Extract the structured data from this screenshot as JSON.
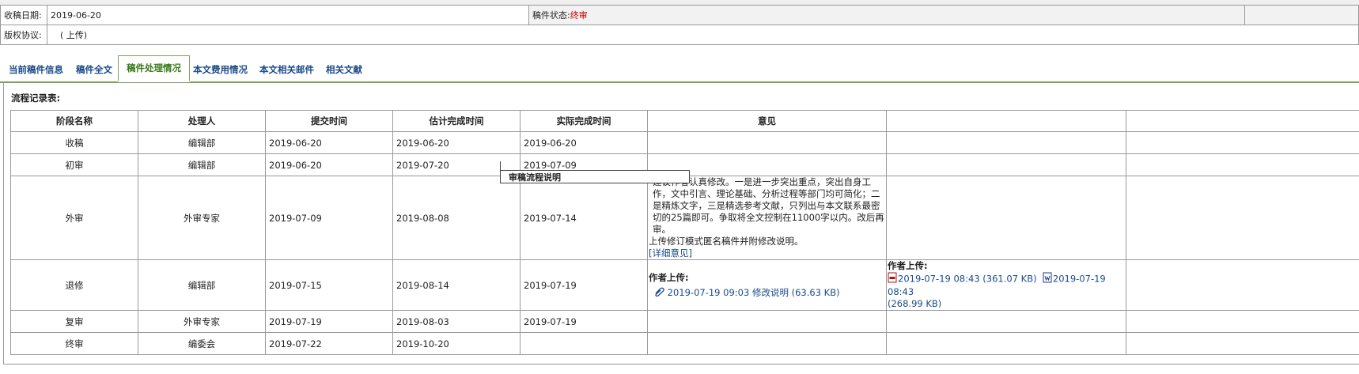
{
  "info": {
    "date_label": "收稿日期:",
    "date_value": "2019-06-20",
    "status_label": "稿件状态:",
    "status_value": "终审",
    "copyright_label": "版权协议:",
    "copyright_value": "( 上传)"
  },
  "tabs": [
    {
      "label": "当前稿件信息"
    },
    {
      "label": "稿件全文"
    },
    {
      "label": "稿件处理情况"
    },
    {
      "label": "本文费用情况"
    },
    {
      "label": "本文相关邮件"
    },
    {
      "label": "相关文献"
    }
  ],
  "panel": {
    "title": "流程记录表:",
    "headers": [
      "阶段名称",
      "处理人",
      "提交时间",
      "估计完成时间",
      "实际完成时间",
      "意见"
    ],
    "rows": [
      {
        "stage": "收稿",
        "handler": "编辑部",
        "submit": "2019-06-20",
        "estimate": "2019-06-20",
        "actual": "2019-06-20"
      },
      {
        "stage": "初审",
        "handler": "编辑部",
        "submit": "2019-06-20",
        "estimate": "2019-07-20",
        "actual": "2019-07-09"
      },
      {
        "stage": "外审",
        "handler": "外审专家",
        "submit": "2019-07-09",
        "estimate": "2019-08-08",
        "actual": "2019-07-14",
        "opinion": "建议作者认真修改。一是进一步突出重点，突出自身工作，文中引言、理论基础、分析过程等部门均可简化；二是精炼文字，三是精选参考文献，只列出与本文联系最密切的25篇即可。争取将全文控制在11000字以内。改后再审。",
        "opinion2": "上传修订模式匿名稿件并附修改说明。",
        "detail_link": "[详细意见]"
      },
      {
        "stage": "退修",
        "handler": "编辑部",
        "submit": "2019-07-15",
        "estimate": "2019-08-14",
        "actual": "2019-07-19",
        "upload_label": "作者上传:",
        "upload_file": "2019-07-19 09:03 修改说明 (63.63 KB)",
        "upload2_label": "作者上传:",
        "upload2_file_a": "2019-07-19 08:43 (361.07 KB)",
        "upload2_file_b": "2019-07-19 08:43",
        "upload2_file_b_size": "(268.99 KB)"
      },
      {
        "stage": "复审",
        "handler": "外审专家",
        "submit": "2019-07-19",
        "estimate": "2019-08-03",
        "actual": "2019-07-19"
      },
      {
        "stage": "终审",
        "handler": "编委会",
        "submit": "2019-07-22",
        "estimate": "2019-10-20",
        "actual": ""
      }
    ]
  },
  "tooltip": {
    "text": "审稿流程说明"
  },
  "colors": {
    "status": "#d40000",
    "link": "#1a4a8a",
    "active_tab": "#3a7a1a"
  }
}
